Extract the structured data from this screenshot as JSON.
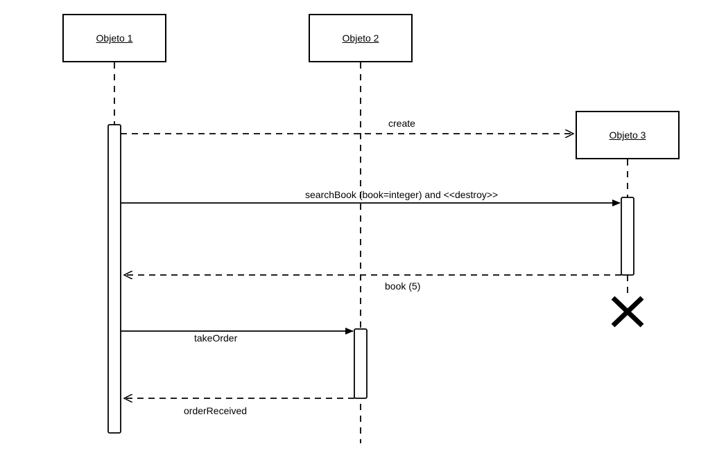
{
  "diagram": {
    "type": "sequence",
    "objects": [
      {
        "id": "obj1",
        "name": "Objeto 1"
      },
      {
        "id": "obj2",
        "name": "Objeto 2"
      },
      {
        "id": "obj3",
        "name": "Objeto 3"
      }
    ],
    "messages": [
      {
        "from": "obj1",
        "to": "obj3",
        "label": "create",
        "type": "create",
        "style": "dashed"
      },
      {
        "from": "obj1",
        "to": "obj3",
        "label": "searchBook (book=integer) and <<destroy>>",
        "type": "call",
        "style": "solid"
      },
      {
        "from": "obj3",
        "to": "obj1",
        "label": "book (5)",
        "type": "return",
        "style": "dashed"
      },
      {
        "from": "obj1",
        "to": "obj2",
        "label": "takeOrder",
        "type": "call",
        "style": "solid"
      },
      {
        "from": "obj2",
        "to": "obj1",
        "label": "orderReceived",
        "type": "return",
        "style": "dashed"
      }
    ],
    "destroy": {
      "object": "obj3"
    }
  },
  "labels": {
    "obj1": "Objeto 1",
    "obj2": "Objeto 2",
    "obj3": "Objeto 3",
    "msg_create": "create",
    "msg_searchbook": "searchBook (book=integer) and <<destroy>>",
    "msg_book": "book (5)",
    "msg_takeorder": "takeOrder",
    "msg_orderreceived": "orderReceived"
  }
}
